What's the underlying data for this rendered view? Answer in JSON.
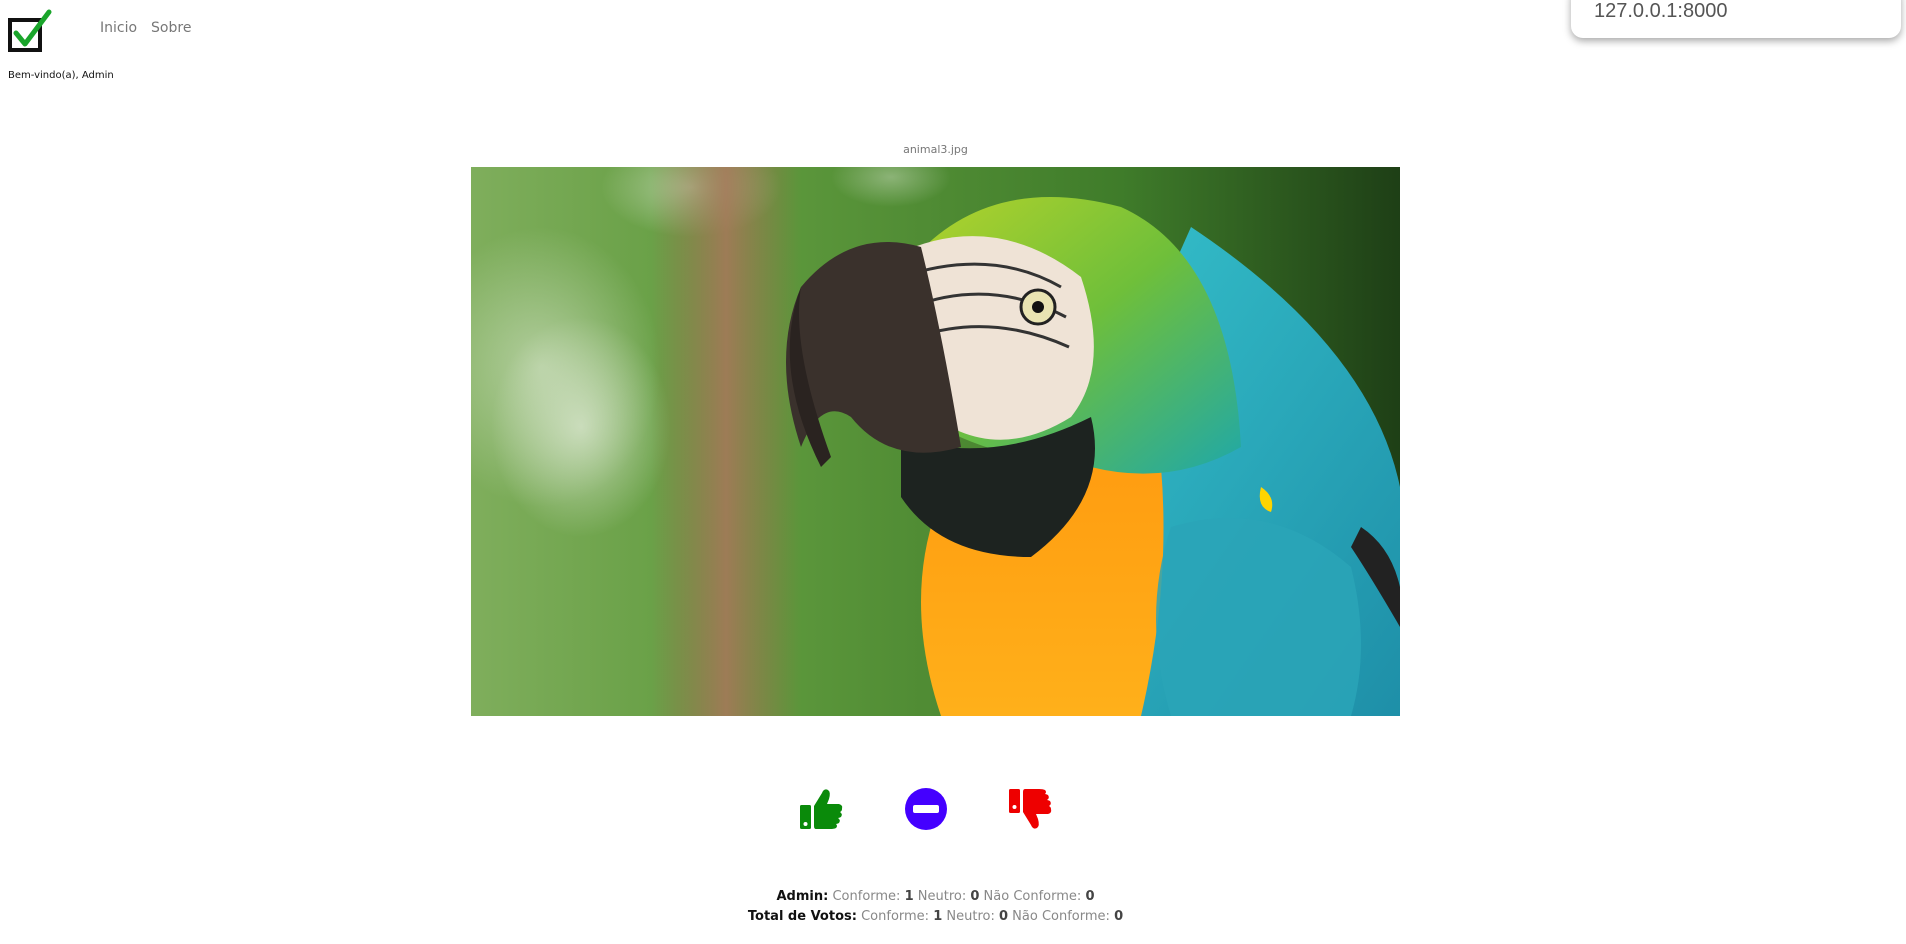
{
  "nav": {
    "logo_icon": "checkbox-check-icon",
    "items": [
      "Inicio",
      "Sobre"
    ]
  },
  "welcome_text": "Bem-vindo(a), Admin",
  "url_popup": "127.0.0.1:8000",
  "image": {
    "filename": "animal3.jpg",
    "subject": "parrot-photo"
  },
  "vote_buttons": [
    {
      "name": "thumbs-up-icon",
      "color": "#0a8a0a"
    },
    {
      "name": "minus-circle-icon",
      "color": "#4400ff"
    },
    {
      "name": "thumbs-down-icon",
      "color": "#ee0000"
    }
  ],
  "stats": {
    "admin": {
      "label": "Admin:",
      "conforme_label": "Conforme:",
      "conforme": "1",
      "neutro_label": "Neutro:",
      "neutro": "0",
      "nao_conforme_label": "Não Conforme:",
      "nao_conforme": "0"
    },
    "total": {
      "label": "Total de Votos:",
      "conforme_label": "Conforme:",
      "conforme": "1",
      "neutro_label": "Neutro:",
      "neutro": "0",
      "nao_conforme_label": "Não Conforme:",
      "nao_conforme": "0"
    }
  },
  "colors": {
    "logo_check": "#1aa52b",
    "nav_text": "#777777",
    "thumbs_up": "#0a8a0a",
    "neutral": "#4400ff",
    "thumbs_down": "#ee0000"
  }
}
